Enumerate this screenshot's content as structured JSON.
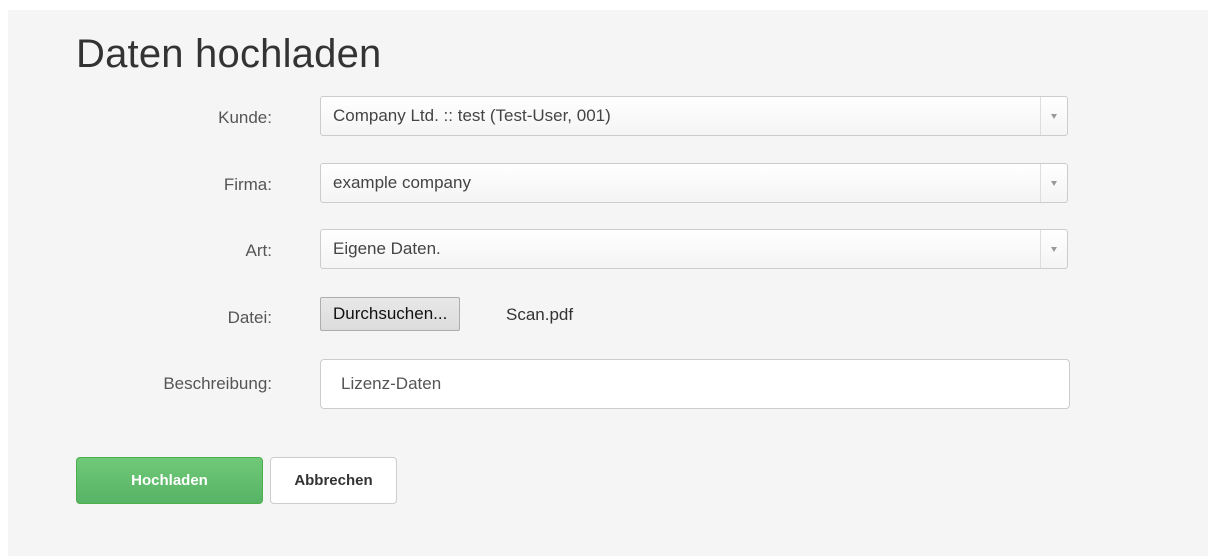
{
  "page": {
    "title": "Daten hochladen"
  },
  "form": {
    "customer": {
      "label": "Kunde:",
      "value": "Company Ltd. :: test (Test-User, 001)"
    },
    "company": {
      "label": "Firma:",
      "value": "example company"
    },
    "type": {
      "label": "Art:",
      "value": "Eigene Daten."
    },
    "file": {
      "label": "Datei:",
      "button_label": "Durchsuchen...",
      "filename": "Scan.pdf"
    },
    "description": {
      "label": "Beschreibung:",
      "value": "Lizenz-Daten"
    }
  },
  "actions": {
    "upload_label": "Hochladen",
    "cancel_label": "Abbrechen"
  },
  "colors": {
    "primary_button": "#5cb85c",
    "background": "#f5f5f5"
  },
  "icons": {
    "select_arrow": "chevron-down-icon"
  }
}
